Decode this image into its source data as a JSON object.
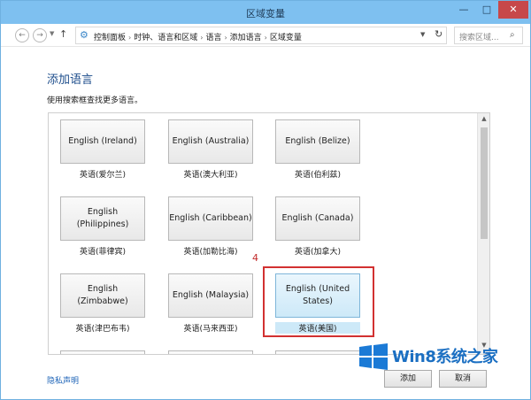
{
  "window": {
    "title": "区域变量",
    "minimize": "—",
    "maximize": "□",
    "close": "✕"
  },
  "address": {
    "back_glyph": "←",
    "forward_glyph": "→",
    "up_glyph": "↑",
    "icon": "control-panel-icon",
    "breadcrumb": [
      "控制面板",
      "时钟、语言和区域",
      "语言",
      "添加语言",
      "区域变量"
    ],
    "separator": "›",
    "refresh_glyph": "↻",
    "search_placeholder": "搜索区域...",
    "search_glyph": "⌕"
  },
  "page": {
    "heading": "添加语言",
    "subheading": "使用搜索框查找更多语言。"
  },
  "tiles": [
    {
      "label": "English (Ireland)",
      "caption": "英语(爱尔兰)"
    },
    {
      "label": "English (Australia)",
      "caption": "英语(澳大利亚)"
    },
    {
      "label": "English (Belize)",
      "caption": "英语(伯利兹)"
    },
    {
      "label": "English (Philippines)",
      "caption": "英语(菲律宾)"
    },
    {
      "label": "English (Caribbean)",
      "caption": "英语(加勒比海)"
    },
    {
      "label": "English (Canada)",
      "caption": "英语(加拿大)"
    },
    {
      "label": "English (Zimbabwe)",
      "caption": "英语(津巴布韦)"
    },
    {
      "label": "English (Malaysia)",
      "caption": "英语(马来西亚)"
    },
    {
      "label": "English (United States)",
      "caption": "英语(美国)",
      "selected": true
    }
  ],
  "annotation": {
    "number": "4",
    "color": "#d23131"
  },
  "footer": {
    "privacy_link": "隐私声明",
    "add_button": "添加",
    "cancel_button": "取消"
  },
  "watermark": {
    "text": "Win8系统之家"
  },
  "colors": {
    "titlebar": "#7ec0f0",
    "heading": "#1e4e8c",
    "link": "#1c63b7",
    "selected_tile": "#cde9f8"
  }
}
